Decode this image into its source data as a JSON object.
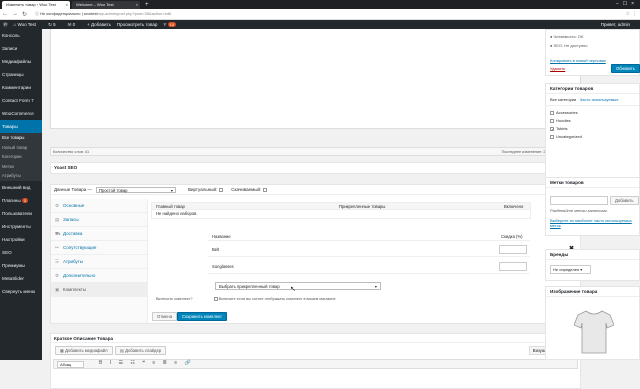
{
  "browser": {
    "tabs": [
      {
        "label": "Изменить товар ‹ Woo Test",
        "active": true
      },
      {
        "label": "Welcome – Woo Test",
        "active": false
      }
    ],
    "new_tab": "+",
    "url_security": "Не конфиденциально",
    "url_host": "wootest",
    "url_path": "/wp-admin/post.php?post=35&action=edit"
  },
  "adminbar": {
    "site": "Woo Test",
    "updates": "5",
    "comments": "0",
    "add": "+ Добавить",
    "view": "Просмотреть товар",
    "notif": "10",
    "greeting": "Привет, admin"
  },
  "sidebar": {
    "items": [
      "Консоль",
      "Записи",
      "Медиафайлы",
      "Страницы",
      "Комментарии",
      "Contact Form 7",
      "WooCommerce",
      "Товары"
    ],
    "sub": [
      "Все товары",
      "Новый товар",
      "Категории",
      "Метки",
      "Атрибуты"
    ],
    "items2": [
      "Внешний вид",
      "Плагины",
      "Пользователи",
      "Инструменты",
      "Настройки",
      "SEO",
      "Премиумы",
      "MetaSlider",
      "Свернуть меню"
    ],
    "plugins_badge": "1"
  },
  "editor": {
    "word_count": "Количество слов: 41",
    "last_edit": "Последнее изменение: 22.03.2018 в 15:41"
  },
  "yoast": {
    "title": "Yoast SEO"
  },
  "product_data": {
    "label": "Данные Товара —",
    "type": "Простой товар",
    "virtual": "Виртуальный:",
    "downloadable": "Скачиваемый:",
    "tabs": [
      "Основные",
      "Запасы",
      "Доставка",
      "Сопутствующие",
      "Атрибуты",
      "Дополнительно",
      "Комплекты"
    ],
    "grid_headers": [
      "Главный товар",
      "Прикрепленные товары",
      "Включено"
    ],
    "grid_empty": "Не найдено наборов.",
    "set_headers": [
      "Название",
      "Скидка (%)"
    ],
    "set_rows": [
      {
        "name": "Belt"
      },
      {
        "name": "Sunglasses"
      }
    ],
    "delete_glyph": "✖",
    "select_placeholder": "Выбрать прикрепленный товар",
    "enable_label": "Включить комплект?",
    "enable_hint": "Включите если вы хотите отображать комплект в вашем магазине",
    "cancel_btn": "Отмена",
    "save_btn": "Сохранить комплект"
  },
  "short_desc": {
    "title": "Краткое Описание Товара",
    "add_media": "Добавить медиафайл",
    "add_slider": "Добавить слайдер",
    "tab_visual": "Визуально",
    "tab_text": "Текст",
    "format": "Абзац"
  },
  "publish": {
    "readability": "Читаемость: OK",
    "seo": "SEO: Не доступно",
    "copy_link": "Копировать в новый черновик",
    "delete_link": "Удалить",
    "update_btn": "Обновить"
  },
  "categories": {
    "title": "Категории товаров",
    "tab_all": "Все категории",
    "tab_used": "Часто используемые",
    "items": [
      {
        "label": "Accessories",
        "checked": false
      },
      {
        "label": "Hoodies",
        "checked": false
      },
      {
        "label": "Tshirts",
        "checked": true
      },
      {
        "label": "Uncategorized",
        "checked": false
      }
    ],
    "add_new": "+ Добавить новую рубрику"
  },
  "tags": {
    "title": "Метки товаров",
    "add_btn": "Добавить",
    "hint": "Разделяйте метки запятыми",
    "popular_link": "Выберите из наиболее часто используемых меток"
  },
  "brands": {
    "title": "Бренды",
    "value": "Не определен"
  },
  "image": {
    "title": "Изображение товара"
  }
}
